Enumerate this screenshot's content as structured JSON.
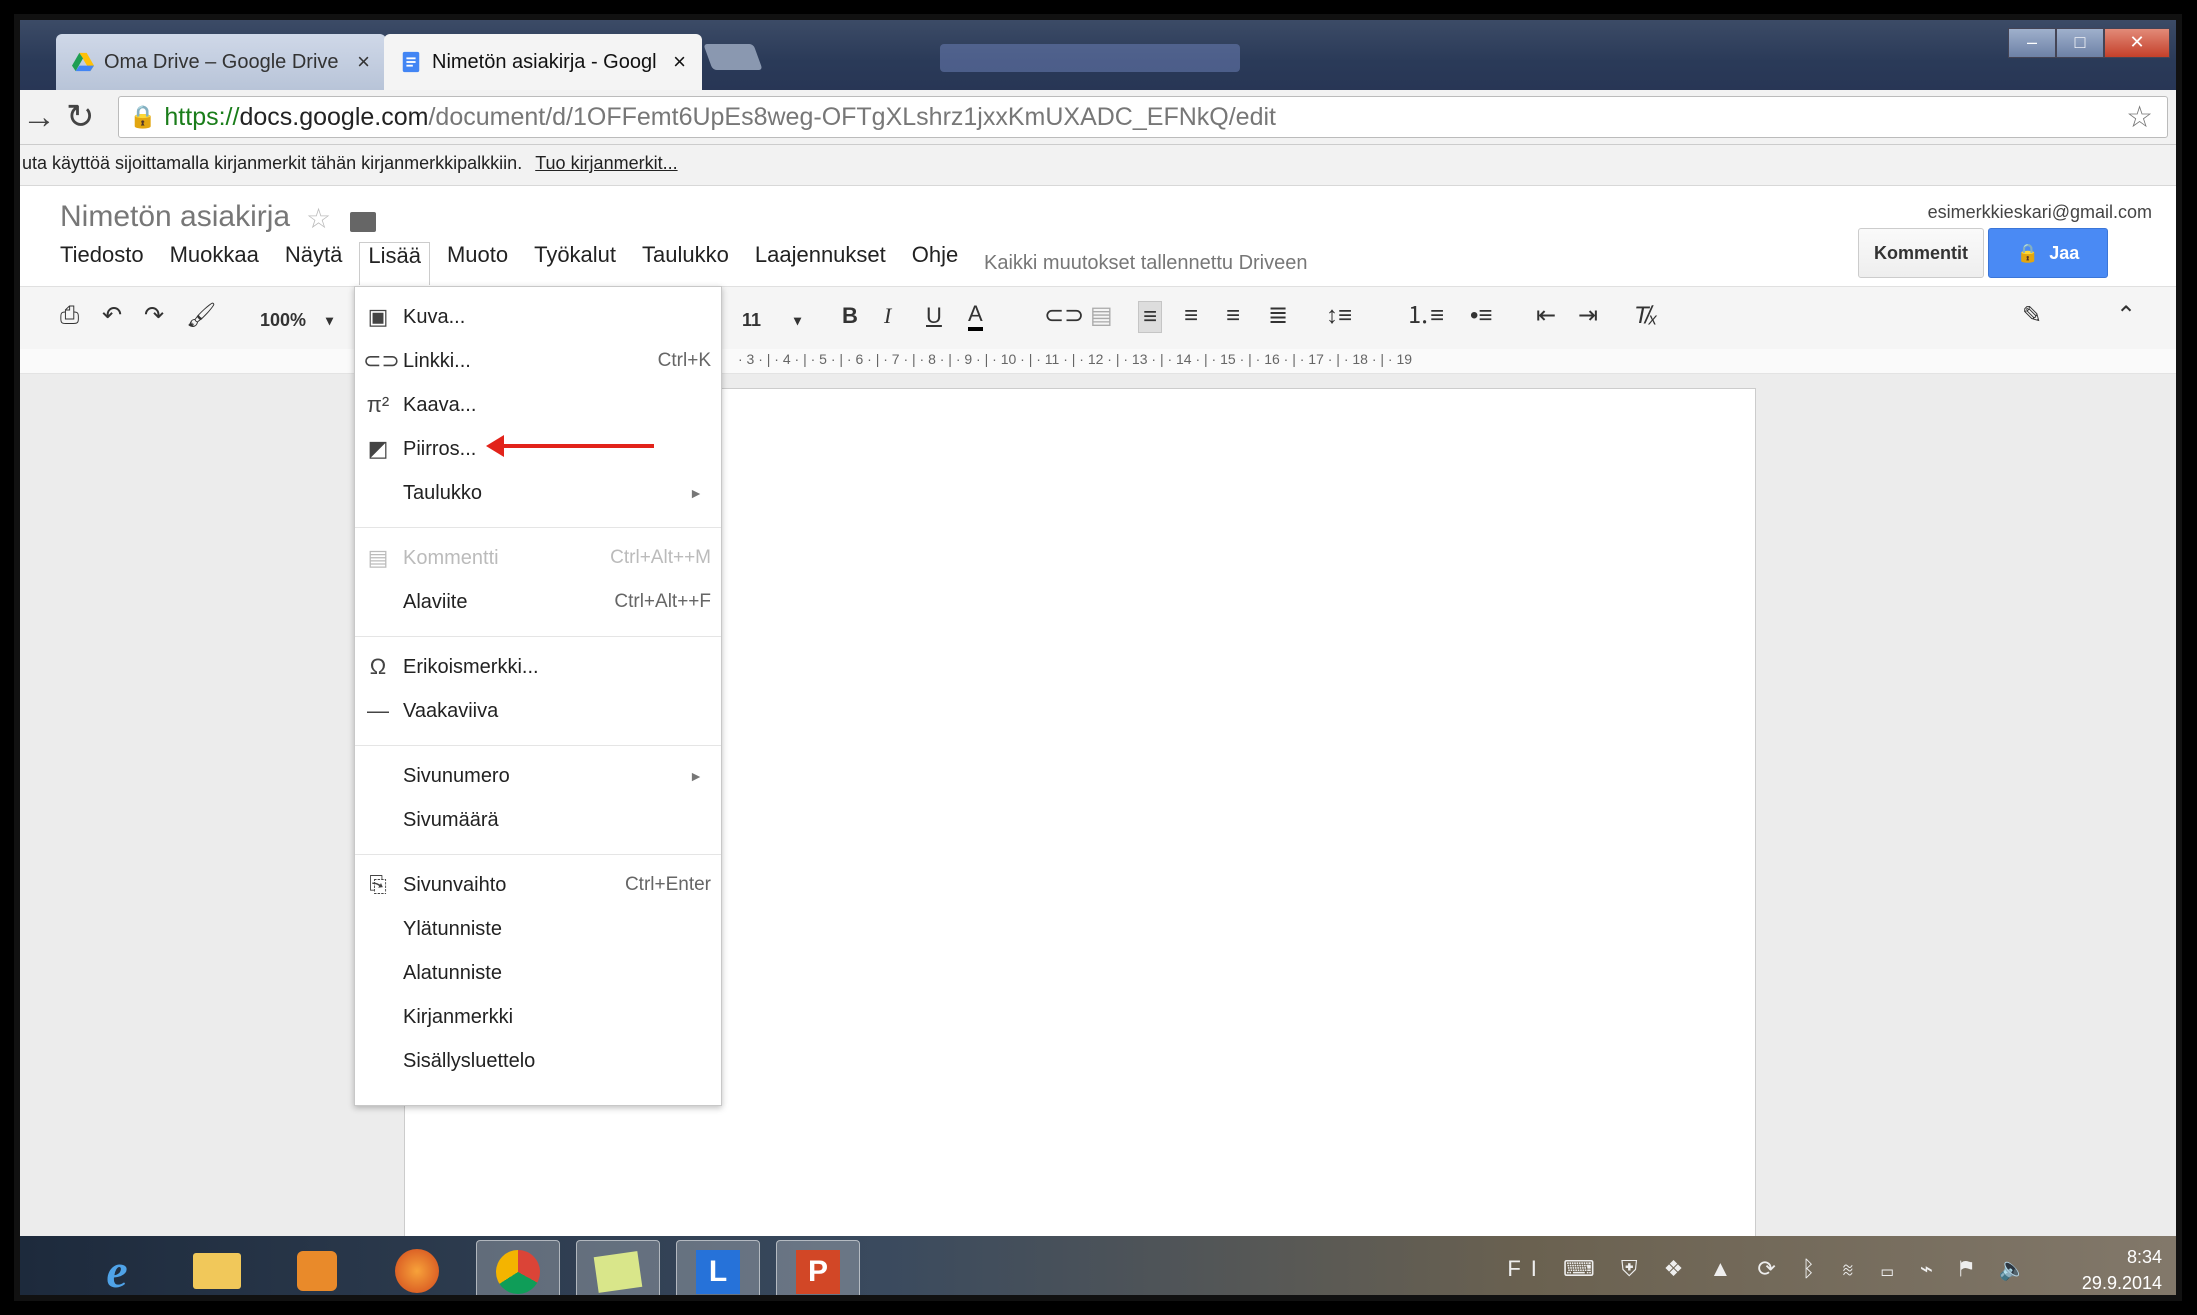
{
  "browser": {
    "tabs": [
      {
        "title": "Oma Drive – Google Drive",
        "close": "×"
      },
      {
        "title": "Nimetön asiakirja - Googl",
        "close": "×"
      }
    ],
    "url": {
      "scheme": "https://",
      "host": "docs.google.com",
      "path": "/document/d/1OFFemt6UpEs8weg-OFTgXLshrz1jxxKmUXADC_EFNkQ/edit"
    },
    "bookmarks_hint": "uta käyttöä sijoittamalla kirjanmerkit tähän kirjanmerkkipalkkiin.",
    "bookmarks_link": "Tuo kirjanmerkit..."
  },
  "docs": {
    "title": "Nimetön asiakirja",
    "menu": [
      "Tiedosto",
      "Muokkaa",
      "Näytä",
      "Lisää",
      "Muoto",
      "Työkalut",
      "Taulukko",
      "Laajennukset",
      "Ohje"
    ],
    "save_status": "Kaikki muutokset tallennettu Driveen",
    "account": "esimerkkieskari@gmail.com",
    "comments_button": "Kommentit",
    "share_button": "Jaa",
    "zoom": "100%",
    "font_size": "11",
    "ruler": "· 3 · | · 4 · | · 5 · | · 6 · | · 7 · | · 8 · | · 9 · | · 10 · | · 11 · | · 12 · | · 13 · | · 14 · | · 15 · | · 16 · | · 17 · | · 18 · | · 19"
  },
  "insert_menu": {
    "items": [
      {
        "label": "Kuva...",
        "shortcut": "",
        "icon": "image-icon"
      },
      {
        "label": "Linkki...",
        "shortcut": "Ctrl+K",
        "icon": "link-icon"
      },
      {
        "label": "Kaava...",
        "shortcut": "",
        "icon": "equation-icon"
      },
      {
        "label": "Piirros...",
        "shortcut": "",
        "icon": "drawing-icon"
      },
      {
        "label": "Taulukko",
        "shortcut": "",
        "icon": "",
        "submenu": true
      },
      {
        "label": "Kommentti",
        "shortcut": "Ctrl+Alt++M",
        "icon": "comment-icon",
        "disabled": true
      },
      {
        "label": "Alaviite",
        "shortcut": "Ctrl+Alt++F",
        "icon": ""
      },
      {
        "label": "Erikoismerkki...",
        "shortcut": "",
        "icon": "omega-icon"
      },
      {
        "label": "Vaakaviiva",
        "shortcut": "",
        "icon": "line-icon"
      },
      {
        "label": "Sivunumero",
        "shortcut": "",
        "icon": "",
        "submenu": true
      },
      {
        "label": "Sivumäärä",
        "shortcut": "",
        "icon": ""
      },
      {
        "label": "Sivunvaihto",
        "shortcut": "Ctrl+Enter",
        "icon": "page-break-icon"
      },
      {
        "label": "Ylätunniste",
        "shortcut": "",
        "icon": ""
      },
      {
        "label": "Alatunniste",
        "shortcut": "",
        "icon": ""
      },
      {
        "label": "Kirjanmerkki",
        "shortcut": "",
        "icon": ""
      },
      {
        "label": "Sisällysluettelo",
        "shortcut": "",
        "icon": ""
      }
    ]
  },
  "taskbar": {
    "language": "FI",
    "time": "8:34",
    "date": "29.9.2014"
  },
  "colors": {
    "accent": "#4a8af4",
    "annotation_arrow": "#e2231a"
  }
}
